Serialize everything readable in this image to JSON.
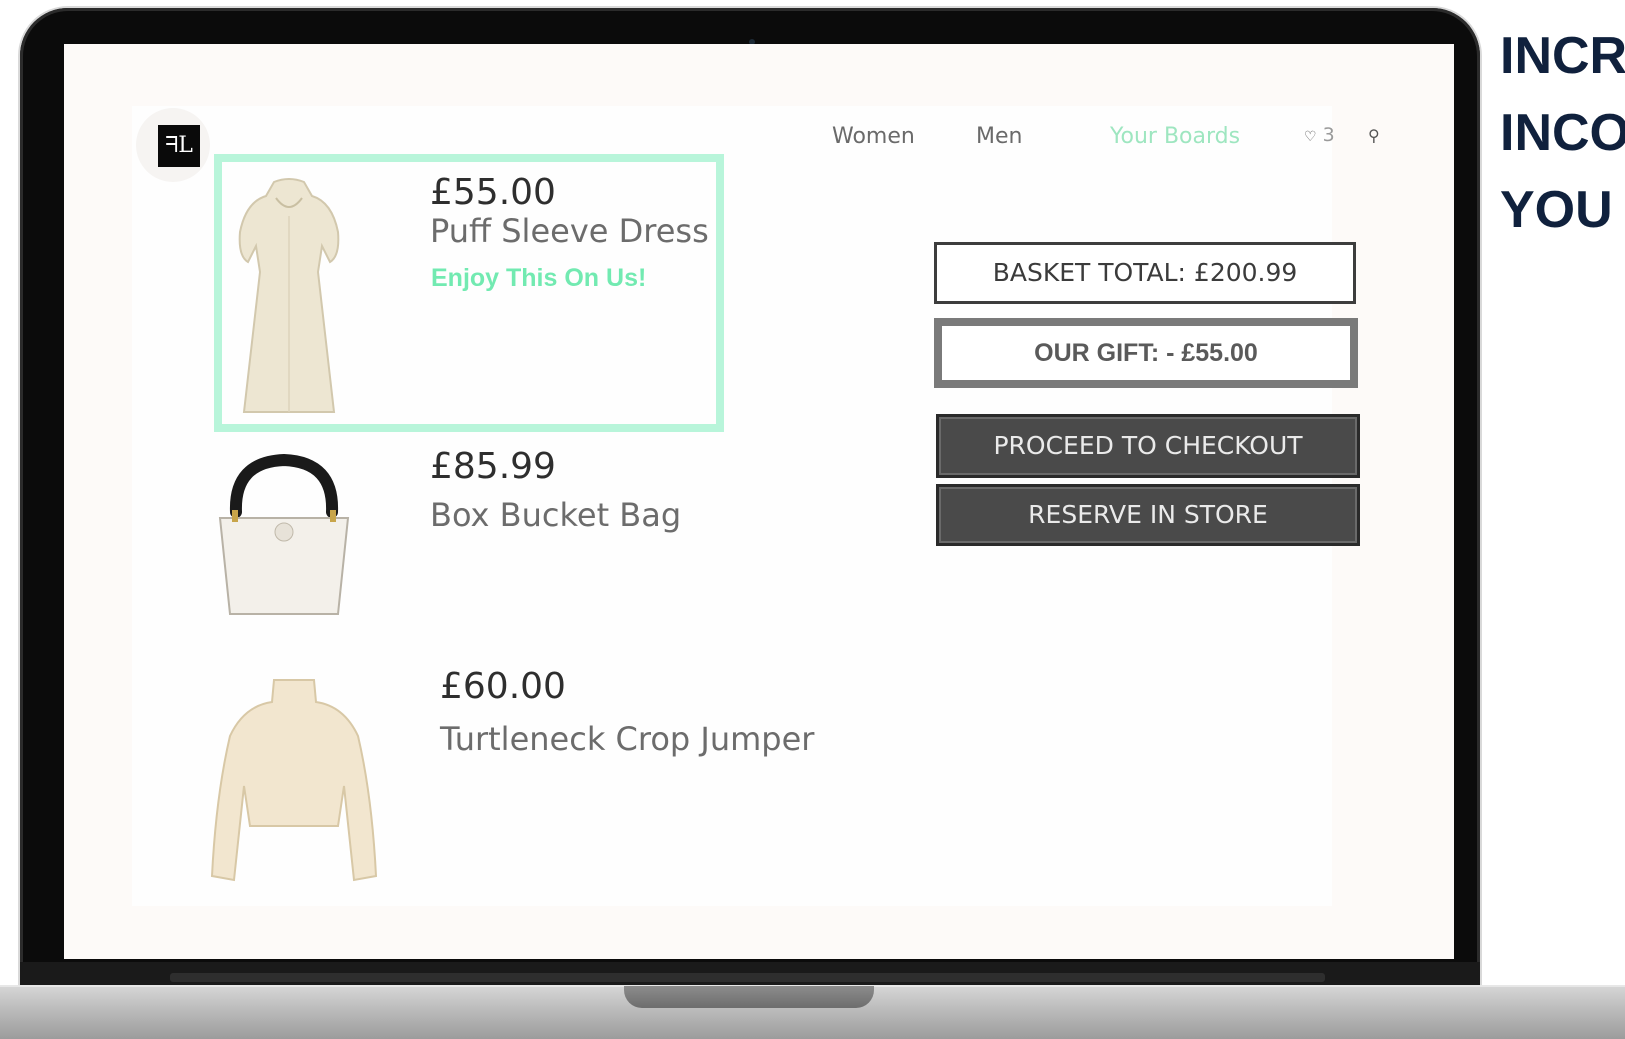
{
  "headline": {
    "lines": [
      "INCR",
      "INCO",
      "YOU"
    ],
    "color": "#10213d"
  },
  "site": {
    "logo_text": "ᖷL",
    "nav": {
      "women": "Women",
      "men": "Men",
      "boards": "Your Boards",
      "basket_count": "3"
    },
    "accent_color": "#9ee6c0"
  },
  "products": [
    {
      "price": "£55.00",
      "name": "Puff Sleeve Dress",
      "note": "Enjoy This On Us!",
      "highlighted": true
    },
    {
      "price": "£85.99",
      "name": "Box Bucket Bag"
    },
    {
      "price": "£60.00",
      "name": "Turtleneck Crop Jumper"
    }
  ],
  "summary": {
    "basket_total": "BASKET TOTAL: £200.99",
    "gift": "OUR GIFT: - £55.00",
    "checkout_label": "PROCEED TO CHECKOUT",
    "reserve_label": "RESERVE IN STORE"
  }
}
